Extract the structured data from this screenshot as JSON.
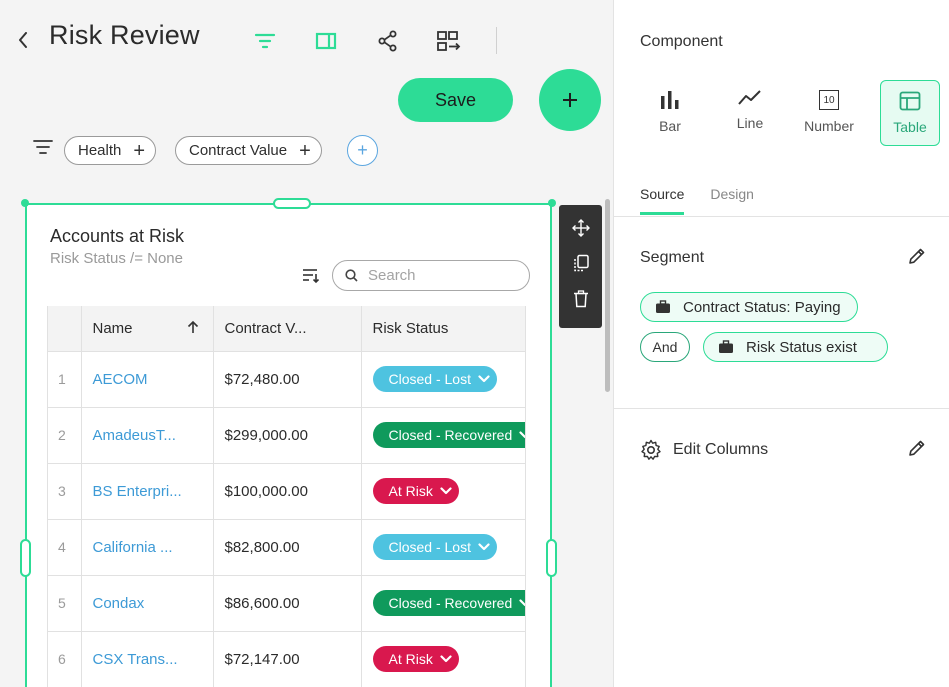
{
  "header": {
    "title": "Risk Review"
  },
  "actions": {
    "save_label": "Save"
  },
  "filters": [
    {
      "label": "Health"
    },
    {
      "label": "Contract Value"
    }
  ],
  "widget": {
    "title": "Accounts at Risk",
    "subtitle": "Risk Status /= None",
    "search_placeholder": "Search",
    "columns": [
      "Name",
      "Contract V...",
      "Risk Status"
    ],
    "rows": [
      {
        "num": "1",
        "name": "AECOM",
        "value": "$72,480.00",
        "status": "Closed - Lost"
      },
      {
        "num": "2",
        "name": "AmadeusT...",
        "value": "$299,000.00",
        "status": "Closed - Recovered"
      },
      {
        "num": "3",
        "name": "BS Enterpri...",
        "value": "$100,000.00",
        "status": "At Risk"
      },
      {
        "num": "4",
        "name": "California ...",
        "value": "$82,800.00",
        "status": "Closed - Lost"
      },
      {
        "num": "5",
        "name": "Condax",
        "value": "$86,600.00",
        "status": "Closed - Recovered"
      },
      {
        "num": "6",
        "name": "CSX Trans...",
        "value": "$72,147.00",
        "status": "At Risk"
      }
    ]
  },
  "status_colors": {
    "Closed - Lost": "#4ec3e0",
    "Closed - Recovered": "#0f9a5c",
    "At Risk": "#d9184e"
  },
  "accent_color": "#2ddc96",
  "panel": {
    "heading": "Component",
    "types": [
      {
        "label": "Bar",
        "icon": "bar-chart-icon"
      },
      {
        "label": "Line",
        "icon": "line-chart-icon"
      },
      {
        "label": "Number",
        "icon": "number-icon",
        "glyph": "10"
      },
      {
        "label": "Table",
        "icon": "table-icon",
        "selected": true
      }
    ],
    "tabs": [
      "Source",
      "Design"
    ],
    "active_tab": "Source",
    "segment_title": "Segment",
    "segment_chips": [
      "Contract Status: Paying",
      "Risk Status exist"
    ],
    "and_label": "And",
    "edit_columns_label": "Edit Columns"
  }
}
